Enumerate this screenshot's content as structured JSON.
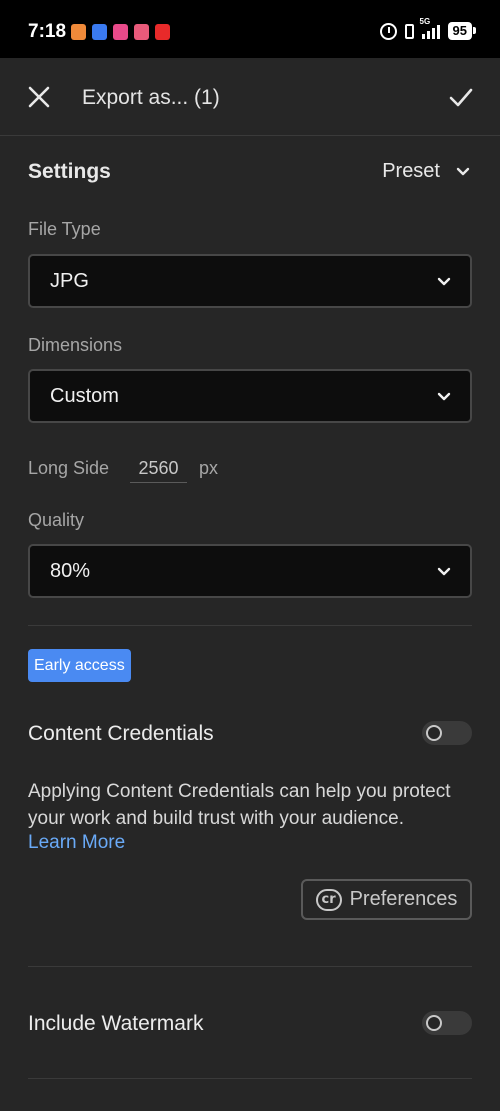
{
  "status_bar": {
    "time": "7:18",
    "network": "5G",
    "battery": "95",
    "notification_icons": [
      {
        "name": "app-notification-icon-1",
        "color": "#f08a3a"
      },
      {
        "name": "app-notification-icon-2",
        "color": "#3a7af0"
      },
      {
        "name": "app-notification-icon-3",
        "color": "#e84a8a"
      },
      {
        "name": "app-notification-icon-4",
        "color": "#e85a7a"
      },
      {
        "name": "youtube-icon",
        "color": "#e82a2a"
      }
    ]
  },
  "app_bar": {
    "title": "Export as... (1)"
  },
  "settings": {
    "title": "Settings",
    "preset_label": "Preset"
  },
  "file_type": {
    "label": "File Type",
    "value": "JPG"
  },
  "dimensions": {
    "label": "Dimensions",
    "value": "Custom"
  },
  "long_side": {
    "label": "Long Side",
    "value": "2560",
    "unit": "px"
  },
  "quality": {
    "label": "Quality",
    "value": "80%"
  },
  "content_credentials": {
    "badge": "Early access",
    "title": "Content Credentials",
    "enabled": false,
    "description": "Applying Content Credentials can help you protect your work and build trust with your audience.",
    "learn_more": "Learn More",
    "preferences_icon_text": "cr",
    "preferences_label": "Preferences"
  },
  "watermark": {
    "title": "Include Watermark",
    "enabled": false
  },
  "colors": {
    "background": "#262626",
    "accent_blue": "#4a8af2",
    "link": "#6aaaf7"
  }
}
